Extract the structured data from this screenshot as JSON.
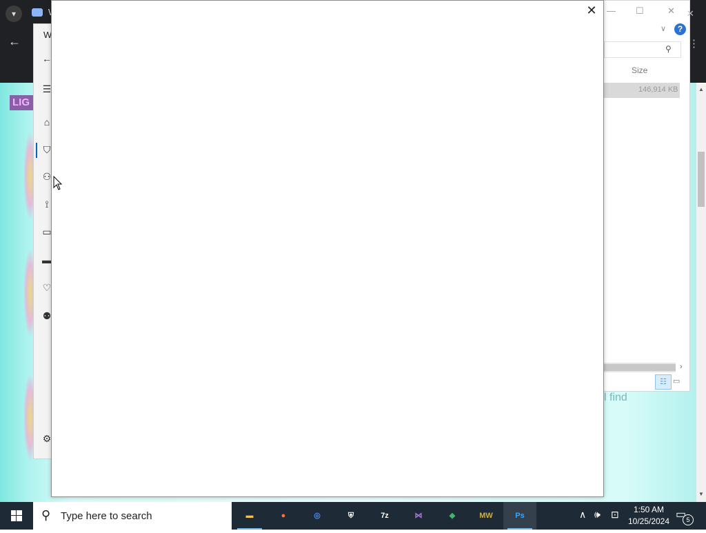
{
  "background": {
    "browser_tab_text": "W",
    "logo_text": "LIG",
    "settings_title": "W",
    "page_text_fragment": "l find",
    "explorer": {
      "size_header": "Size",
      "row_size": "146,914 KB",
      "help_label": "?"
    }
  },
  "dialog": {
    "close_label": "✕"
  },
  "taskbar": {
    "search_placeholder": "Type here to search",
    "apps": [
      {
        "name": "File Explorer",
        "glyph": "▬",
        "color": "#f2c14e",
        "running": true
      },
      {
        "name": "Firefox",
        "glyph": "●",
        "color": "#ff7139",
        "running": false
      },
      {
        "name": "Chromium",
        "glyph": "◎",
        "color": "#4c8bf5",
        "running": false
      },
      {
        "name": "Windows Security",
        "glyph": "⛨",
        "color": "#ffffff",
        "running": false
      },
      {
        "name": "7-Zip",
        "glyph": "7z",
        "color": "#ffffff",
        "running": false
      },
      {
        "name": "Visual Studio",
        "glyph": "⋈",
        "color": "#a77bda",
        "running": false
      },
      {
        "name": "Tree App",
        "glyph": "◆",
        "color": "#45b36b",
        "running": false
      },
      {
        "name": "NFS MW",
        "glyph": "MW",
        "color": "#c7b04a",
        "running": false
      },
      {
        "name": "Photoshop",
        "glyph": "Ps",
        "color": "#31a8ff",
        "running": true
      }
    ],
    "time": "1:50 AM",
    "date": "10/25/2024",
    "notification_count": "5"
  }
}
